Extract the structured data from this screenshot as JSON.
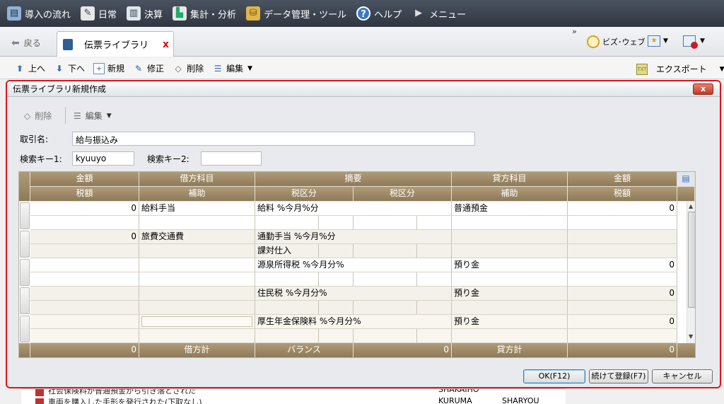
{
  "menubar": {
    "items": [
      {
        "label": "導入の流れ",
        "icon": "flow-icon"
      },
      {
        "label": "日常",
        "icon": "daily-icon"
      },
      {
        "label": "決算",
        "icon": "settlement-icon"
      },
      {
        "label": "集計・分析",
        "icon": "chart-icon"
      },
      {
        "label": "データ管理・ツール",
        "icon": "database-icon"
      },
      {
        "label": "ヘルプ",
        "icon": "help-icon"
      },
      {
        "label": "メニュー",
        "icon": "play-icon"
      }
    ]
  },
  "tabbar": {
    "back_label": "戻る",
    "tab_label": "伝票ライブラリ",
    "tab_close": "x",
    "overflow": "»",
    "bizweb_label": "ビズ･ウェブ"
  },
  "toolbar": {
    "up": "上へ",
    "down": "下へ",
    "new": "新規",
    "edit": "修正",
    "delete": "削除",
    "edit_menu": "編集",
    "export": "エクスポート"
  },
  "dialog": {
    "title": "伝票ライブラリ新規作成",
    "close": "x",
    "delete": "削除",
    "edit": "編集",
    "torihiki_label": "取引名:",
    "torihiki_value": "給与振込み",
    "key1_label": "検索キー1:",
    "key1_value": "kyuuyo",
    "key2_label": "検索キー2:",
    "key2_value": "",
    "headers_top": [
      "金額",
      "借方科目",
      "摘要",
      "貸方科目",
      "金額"
    ],
    "headers_bottom": [
      "税額",
      "補助",
      "税区分",
      "税区分",
      "補助",
      "税額"
    ],
    "rows": [
      {
        "amount": "0",
        "debit": "給料手当",
        "summary": "給料 %今月%分",
        "credit": "普通預金",
        "credit_amount": "0"
      },
      {
        "amount": "0",
        "debit": "旅費交通費",
        "summary": "通勤手当 %今月%分",
        "summary2": "課対仕入",
        "credit": "",
        "credit_amount": ""
      },
      {
        "amount": "",
        "debit": "",
        "summary": "源泉所得税 %今月分%",
        "credit": "預り金",
        "credit_amount": "0"
      },
      {
        "amount": "",
        "debit": "",
        "summary": "住民税 %今月分%",
        "credit": "預り金",
        "credit_amount": "0"
      },
      {
        "amount": "",
        "debit": "",
        "summary": "厚生年金保険料 %今月分%",
        "credit": "預り金",
        "credit_amount": "0"
      }
    ],
    "footer": {
      "debit_total_value": "0",
      "debit_total_label": "借方計",
      "balance_label": "バランス",
      "balance_value": "0",
      "credit_total_label": "貸方計",
      "credit_total_value": "0"
    },
    "buttons": {
      "ok": "OK(F12)",
      "continue": "続けて登録(F7)",
      "cancel": "キャンセル"
    }
  },
  "background_list": [
    {
      "text": "社会保険料が普通預金から引き落とされた",
      "code": "SHAKAIHO"
    },
    {
      "text": "車両を購入した手形を発行された(下取なし)",
      "code": "KURUMA",
      "code2": "SHARYOU"
    }
  ]
}
